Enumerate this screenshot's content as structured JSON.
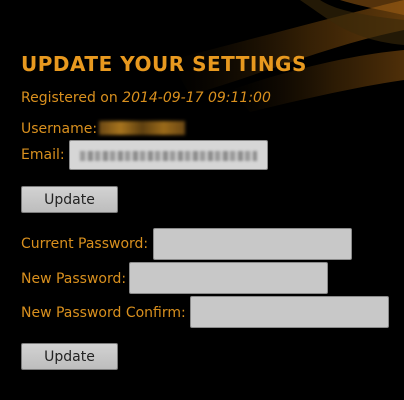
{
  "page": {
    "title": "UPDATE YOUR SETTINGS",
    "registered_prefix": "Registered on ",
    "registered_timestamp": "2014-09-17 09:11:00"
  },
  "account": {
    "username_label": "Username:",
    "email_label": "Email:"
  },
  "buttons": {
    "update_label": "Update"
  },
  "password": {
    "current_label": "Current Password:",
    "new_label": "New Password:",
    "confirm_label": "New Password Confirm:",
    "current_value": "",
    "new_value": "",
    "confirm_value": ""
  },
  "colors": {
    "background": "#000000",
    "accent": "#d9901e",
    "field": "#c8c8c8"
  }
}
